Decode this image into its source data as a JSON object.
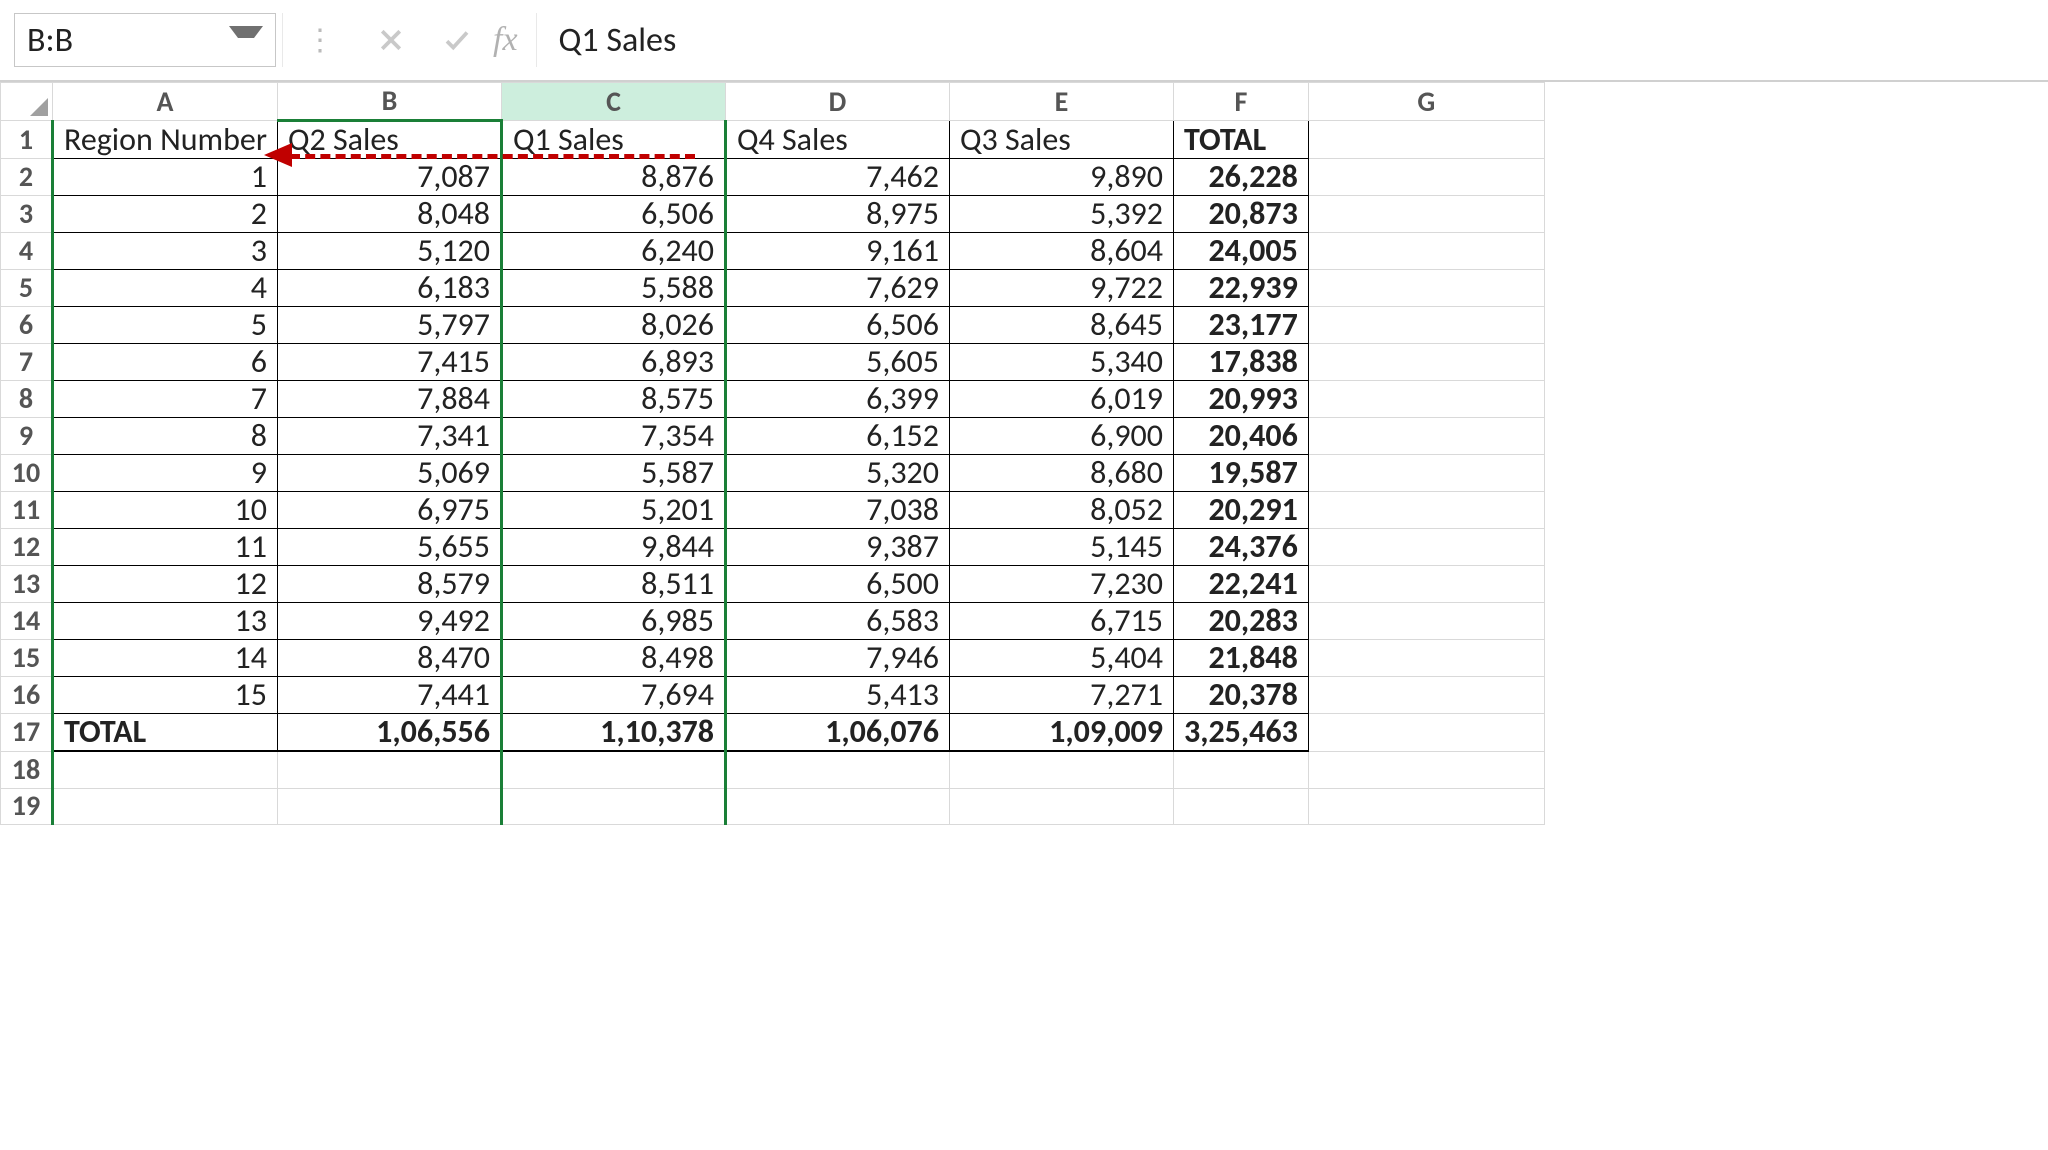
{
  "formula_bar": {
    "name_box": "B:B",
    "fx_label": "fx",
    "formula_value": "Q1 Sales"
  },
  "columns": [
    "A",
    "B",
    "C",
    "D",
    "E",
    "F",
    "G"
  ],
  "row_numbers": [
    1,
    2,
    3,
    4,
    5,
    6,
    7,
    8,
    9,
    10,
    11,
    12,
    13,
    14,
    15,
    16,
    17,
    18,
    19
  ],
  "headers": {
    "A": "Region Number",
    "B": "Q2 Sales",
    "C": "Q1 Sales",
    "D": "Q4 Sales",
    "E": "Q3 Sales",
    "F": "TOTAL"
  },
  "rows": [
    {
      "A": "1",
      "B": "7,087",
      "C": "8,876",
      "D": "7,462",
      "E": "9,890",
      "F": "26,228"
    },
    {
      "A": "2",
      "B": "8,048",
      "C": "6,506",
      "D": "8,975",
      "E": "5,392",
      "F": "20,873"
    },
    {
      "A": "3",
      "B": "5,120",
      "C": "6,240",
      "D": "9,161",
      "E": "8,604",
      "F": "24,005"
    },
    {
      "A": "4",
      "B": "6,183",
      "C": "5,588",
      "D": "7,629",
      "E": "9,722",
      "F": "22,939"
    },
    {
      "A": "5",
      "B": "5,797",
      "C": "8,026",
      "D": "6,506",
      "E": "8,645",
      "F": "23,177"
    },
    {
      "A": "6",
      "B": "7,415",
      "C": "6,893",
      "D": "5,605",
      "E": "5,340",
      "F": "17,838"
    },
    {
      "A": "7",
      "B": "7,884",
      "C": "8,575",
      "D": "6,399",
      "E": "6,019",
      "F": "20,993"
    },
    {
      "A": "8",
      "B": "7,341",
      "C": "7,354",
      "D": "6,152",
      "E": "6,900",
      "F": "20,406"
    },
    {
      "A": "9",
      "B": "5,069",
      "C": "5,587",
      "D": "5,320",
      "E": "8,680",
      "F": "19,587"
    },
    {
      "A": "10",
      "B": "6,975",
      "C": "5,201",
      "D": "7,038",
      "E": "8,052",
      "F": "20,291"
    },
    {
      "A": "11",
      "B": "5,655",
      "C": "9,844",
      "D": "9,387",
      "E": "5,145",
      "F": "24,376"
    },
    {
      "A": "12",
      "B": "8,579",
      "C": "8,511",
      "D": "6,500",
      "E": "7,230",
      "F": "22,241"
    },
    {
      "A": "13",
      "B": "9,492",
      "C": "6,985",
      "D": "6,583",
      "E": "6,715",
      "F": "20,283"
    },
    {
      "A": "14",
      "B": "8,470",
      "C": "8,498",
      "D": "7,946",
      "E": "5,404",
      "F": "21,848"
    },
    {
      "A": "15",
      "B": "7,441",
      "C": "7,694",
      "D": "5,413",
      "E": "7,271",
      "F": "20,378"
    }
  ],
  "totals": {
    "label": "TOTAL",
    "B": "1,06,556",
    "C": "1,10,378",
    "D": "1,06,076",
    "E": "1,09,009",
    "F": "3,25,463"
  },
  "chart_data": {
    "type": "table",
    "title": "Quarterly Sales by Region",
    "columns": [
      "Region Number",
      "Q2 Sales",
      "Q1 Sales",
      "Q4 Sales",
      "Q3 Sales",
      "TOTAL"
    ],
    "rows": [
      [
        1,
        7087,
        8876,
        7462,
        9890,
        26228
      ],
      [
        2,
        8048,
        6506,
        8975,
        5392,
        20873
      ],
      [
        3,
        5120,
        6240,
        9161,
        8604,
        24005
      ],
      [
        4,
        6183,
        5588,
        7629,
        9722,
        22939
      ],
      [
        5,
        5797,
        8026,
        6506,
        8645,
        23177
      ],
      [
        6,
        7415,
        6893,
        5605,
        5340,
        17838
      ],
      [
        7,
        7884,
        8575,
        6399,
        6019,
        20993
      ],
      [
        8,
        7341,
        7354,
        6152,
        6900,
        20406
      ],
      [
        9,
        5069,
        5587,
        5320,
        8680,
        19587
      ],
      [
        10,
        6975,
        5201,
        7038,
        8052,
        20291
      ],
      [
        11,
        5655,
        9844,
        9387,
        5145,
        24376
      ],
      [
        12,
        8579,
        8511,
        6500,
        7230,
        22241
      ],
      [
        13,
        9492,
        6985,
        6583,
        6715,
        20283
      ],
      [
        14,
        8470,
        8498,
        7946,
        5404,
        21848
      ],
      [
        15,
        7441,
        7694,
        5413,
        7271,
        20378
      ]
    ],
    "totals": {
      "Q2 Sales": 106556,
      "Q1 Sales": 110378,
      "Q4 Sales": 106076,
      "Q3 Sales": 109009,
      "TOTAL": 325463
    }
  }
}
